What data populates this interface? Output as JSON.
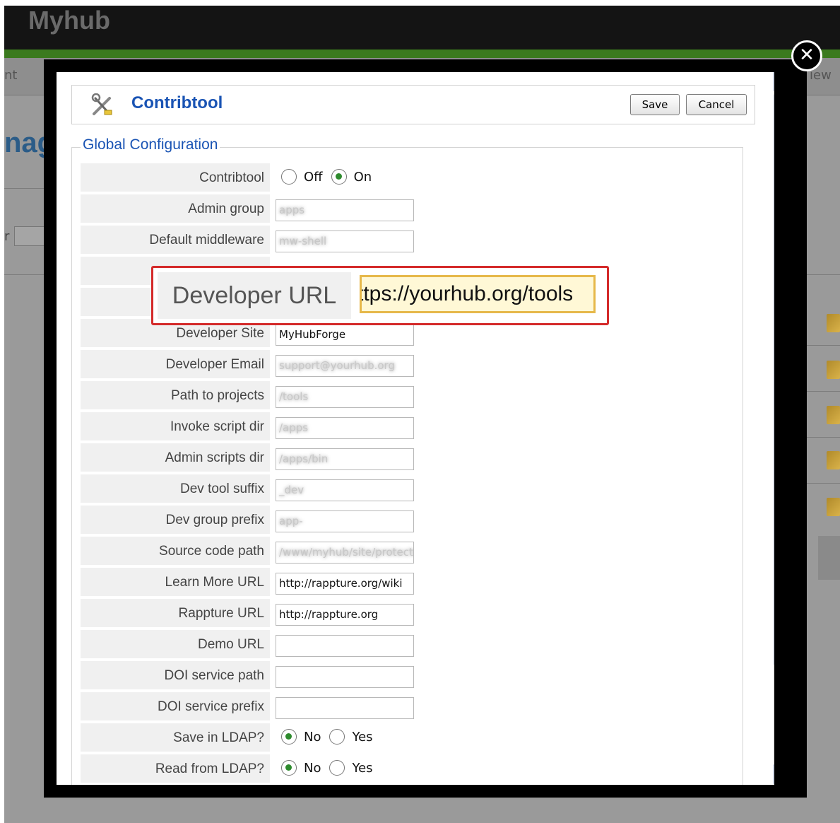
{
  "background": {
    "logo": "Myhub",
    "nav_left": "nt",
    "nav_right": "iew",
    "title_fragment": "nag",
    "filter_label": "r"
  },
  "modal": {
    "component_title": "Contribtool",
    "save_label": "Save",
    "cancel_label": "Cancel",
    "legend": "Global Configuration",
    "close_glyph": "✕",
    "highlight": {
      "label": "Developer URL",
      "value": "ttps://yourhub.org/tools"
    },
    "fields": [
      {
        "label": "Contribtool",
        "type": "radio",
        "options": [
          {
            "label": "Off",
            "checked": false
          },
          {
            "label": "On",
            "checked": true
          }
        ]
      },
      {
        "label": "Admin group",
        "type": "text",
        "value": "apps",
        "blurred": true
      },
      {
        "label": "Default middleware",
        "type": "text",
        "value": "mw-shell",
        "blurred": true
      },
      {
        "label": "Developer Site",
        "type": "text",
        "value": "MyHubForge",
        "blurred": false
      },
      {
        "label": "Developer Email",
        "type": "text",
        "value": "support@yourhub.org",
        "blurred": true
      },
      {
        "label": "Path to projects",
        "type": "text",
        "value": "/tools",
        "blurred": true
      },
      {
        "label": "Invoke script dir",
        "type": "text",
        "value": "/apps",
        "blurred": true
      },
      {
        "label": "Admin scripts dir",
        "type": "text",
        "value": "/apps/bin",
        "blurred": true
      },
      {
        "label": "Dev tool suffix",
        "type": "text",
        "value": "_dev",
        "blurred": true
      },
      {
        "label": "Dev group prefix",
        "type": "text",
        "value": "app-",
        "blurred": true
      },
      {
        "label": "Source code path",
        "type": "text",
        "value": "/www/myhub/site/protected",
        "blurred": true
      },
      {
        "label": "Learn More URL",
        "type": "text",
        "value": "http://rappture.org/wiki",
        "blurred": false
      },
      {
        "label": "Rappture URL",
        "type": "text",
        "value": "http://rappture.org",
        "blurred": false
      },
      {
        "label": "Demo URL",
        "type": "text",
        "value": "",
        "blurred": false
      },
      {
        "label": "DOI service path",
        "type": "text",
        "value": "",
        "blurred": false
      },
      {
        "label": "DOI service prefix",
        "type": "text",
        "value": "",
        "blurred": false
      },
      {
        "label": "Save in LDAP?",
        "type": "radio",
        "options": [
          {
            "label": "No",
            "checked": true
          },
          {
            "label": "Yes",
            "checked": false
          }
        ]
      },
      {
        "label": "Read from LDAP?",
        "type": "radio",
        "options": [
          {
            "label": "No",
            "checked": true
          },
          {
            "label": "Yes",
            "checked": false
          }
        ]
      }
    ]
  },
  "colors": {
    "accent_blue": "#1a54b4",
    "highlight_red": "#d42a2a",
    "input_highlight": "#fff8d6",
    "radio_checked": "#2e8b2e"
  }
}
